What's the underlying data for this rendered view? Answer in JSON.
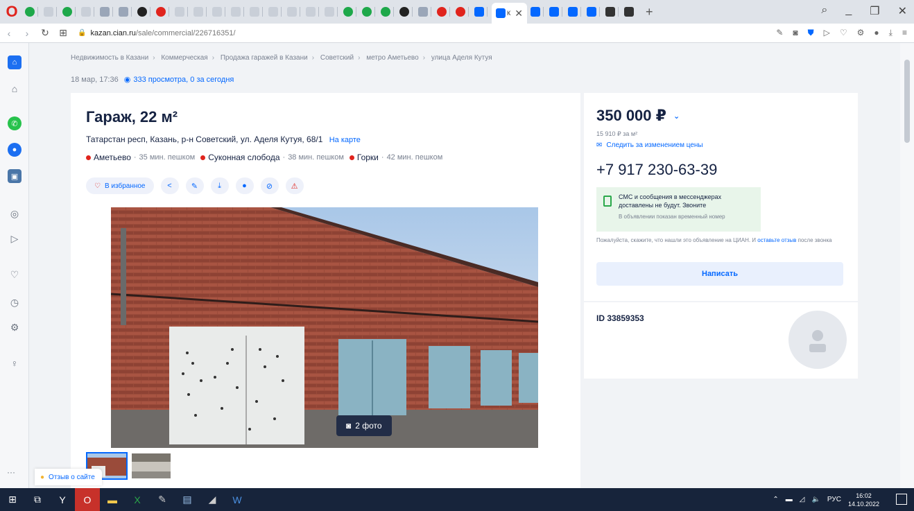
{
  "browser": {
    "active_tab_label": "К",
    "url_host": "kazan.cian.ru",
    "url_path": "/sale/commercial/226716351/"
  },
  "breadcrumbs": [
    "Недвижимость в Казани",
    "Коммерческая",
    "Продажа гаражей в Казани",
    "Советский",
    "метро Аметьево",
    "улица Аделя Кутуя"
  ],
  "meta": {
    "date": "18 мар, 17:36",
    "views": "333 просмотра, 0 за сегодня"
  },
  "listing": {
    "title": "Гараж, 22 м²",
    "address": "Татарстан респ, Казань, р-н Советский, ул. Аделя Кутуя, 68/1",
    "map_link": "На карте",
    "metros": [
      {
        "name": "Аметьево",
        "walk": "35 мин. пешком"
      },
      {
        "name": "Суконная слобода",
        "walk": "38 мин. пешком"
      },
      {
        "name": "Горки",
        "walk": "42 мин. пешком"
      }
    ],
    "favorite_label": "В избранное",
    "photo_count": "2 фото"
  },
  "price_card": {
    "price": "350 000 ₽",
    "price_per_meter": "15 910 ₽ за м²",
    "follow_price": "Следить за изменением цены",
    "phone": "+7 917 230-63-39",
    "sms_main": "СМС и сообщения в мессенджерах доставлены не будут. Звоните",
    "sms_sub": "В объявлении показан временный номер",
    "note_text": "Пожалуйста, скажите, что нашли это объявление на ЦИАН. И",
    "note_link": "оставьте отзыв",
    "note_tail": "после звонка",
    "write_button": "Написать"
  },
  "owner": {
    "id": "ID 33859353"
  },
  "feedback_label": "Отзыв о сайте",
  "taskbar": {
    "lang": "РУС",
    "time": "16:02",
    "date": "14.10.2022"
  }
}
